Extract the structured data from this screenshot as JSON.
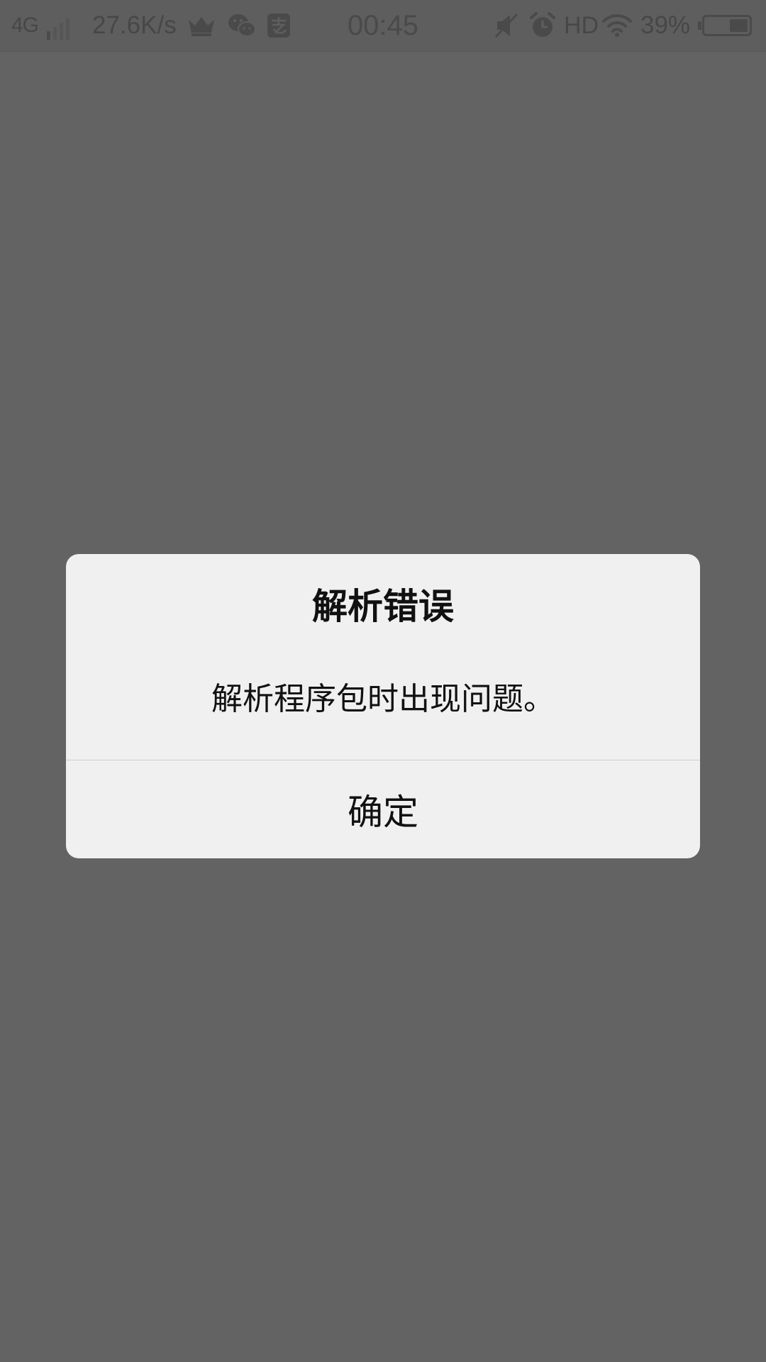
{
  "status_bar": {
    "network": "4G",
    "speed": "27.6K/s",
    "time": "00:45",
    "hd": "HD",
    "battery_percent": "39%",
    "battery_level": 0.39,
    "icons": [
      "crown-icon",
      "wechat-icon",
      "alipay-icon",
      "mute-icon",
      "alarm-icon",
      "wifi-icon",
      "battery-icon"
    ]
  },
  "dialog": {
    "title": "解析错误",
    "message": "解析程序包时出现问题。",
    "confirm_label": "确定"
  },
  "colors": {
    "overlay": "#636363",
    "dialog_bg": "#f0f0f0",
    "text": "#111111",
    "divider": "#cfcfcf"
  }
}
